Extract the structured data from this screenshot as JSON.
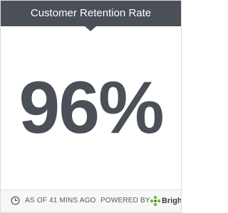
{
  "widget": {
    "title": "Customer Retention Rate",
    "value": "96%"
  },
  "footer": {
    "timestamp": "AS OF 41 MINS AGO",
    "powered_by": "POWERED BY",
    "brand": "Bright"
  },
  "colors": {
    "header_bg": "#4b4f58",
    "value_text": "#4b4f58",
    "brand_logo_green": "#6abf2e"
  },
  "icons": {
    "timestamp": "clock-icon",
    "brand": "brand-logo-icon"
  }
}
